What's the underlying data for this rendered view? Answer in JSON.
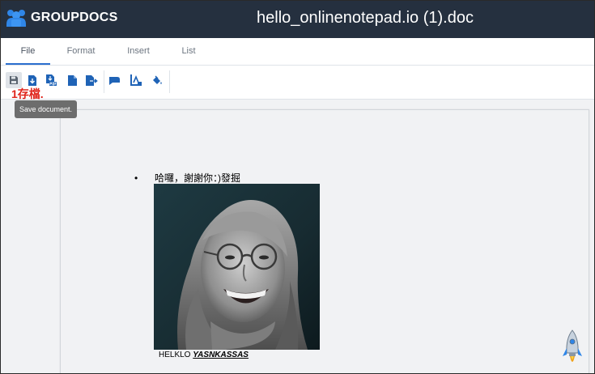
{
  "header": {
    "brand": "GROUPDOCS",
    "document_title": "hello_onlinenotepad.io (1).doc",
    "brand_color": "#25303f"
  },
  "tabs": [
    {
      "label": "File",
      "active": true
    },
    {
      "label": "Format",
      "active": false
    },
    {
      "label": "Insert",
      "active": false
    },
    {
      "label": "List",
      "active": false
    }
  ],
  "toolbar": {
    "buttons": [
      "save-icon",
      "download-icon",
      "export-pdf-icon",
      "new-document-icon",
      "open-file-icon",
      "comment-icon",
      "text-color-icon",
      "fill-color-icon"
    ],
    "active_button": "save-icon",
    "accent_color": "#2b6fcf"
  },
  "tooltip": {
    "text": "Save document."
  },
  "annotation": {
    "text": "1存檔.",
    "color": "#e0241b"
  },
  "document": {
    "list_item": "哈囉，謝謝你：)發掘",
    "image": "portrait-photo",
    "caption_plain": "HELKLO ",
    "caption_emphasis": "YASNKASSAS"
  }
}
